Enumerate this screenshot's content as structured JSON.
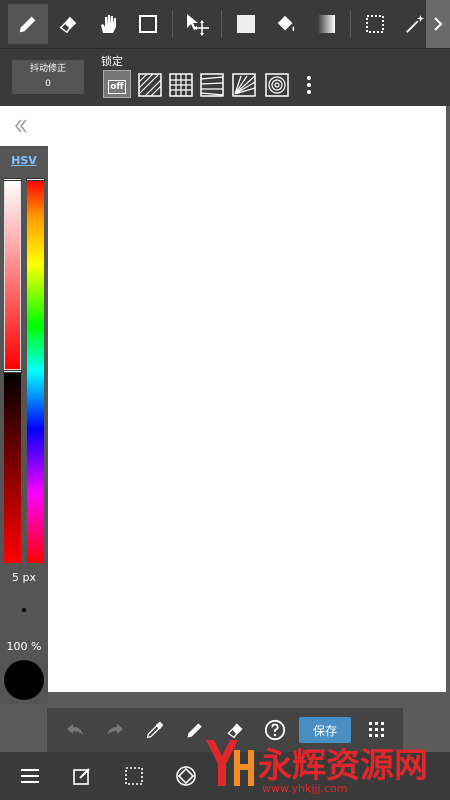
{
  "top_toolbar": {
    "tools": [
      "pencil-icon",
      "eraser-icon",
      "hand-icon",
      "rectangle-icon",
      "move-icon",
      "fill-square-icon",
      "bucket-icon",
      "gradient-icon",
      "select-icon",
      "magic-wand-icon"
    ],
    "next": "chevron-right-icon"
  },
  "options": {
    "stabilizer_label": "抖动修正",
    "stabilizer_value": "0",
    "lock_label": "锁定",
    "lock_off": "off"
  },
  "color_panel": {
    "mode": "HSV",
    "brush_size": "5 px",
    "opacity": "100 %",
    "current_color": "#000000"
  },
  "action_bar": {
    "save_label": "保存"
  },
  "watermark": {
    "text": "永辉资源网",
    "url": "www.yhkjjj.com"
  },
  "colors": {
    "toolbar_bg": "#3a3a3a",
    "accent": "#4a8fc4",
    "watermark_red": "#e0272b"
  }
}
